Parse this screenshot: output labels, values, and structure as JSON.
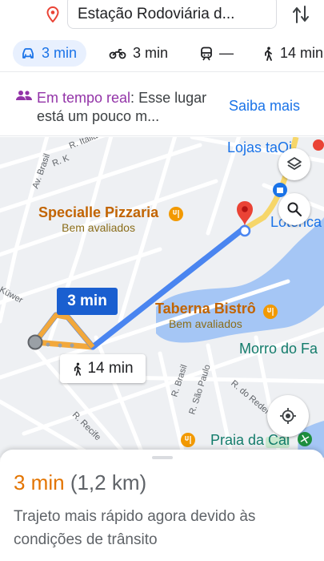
{
  "search": {
    "destination": "Estação Rodoviária d...",
    "pin_icon": "location-pin-icon",
    "swap_icon": "swap-vertical-icon"
  },
  "modes": {
    "car": {
      "label": "3 min",
      "icon": "car-icon",
      "active": true
    },
    "motorcycle": {
      "label": "3 min",
      "icon": "motorcycle-icon"
    },
    "transit": {
      "label": "—",
      "icon": "train-icon"
    },
    "walk": {
      "label": "14 min",
      "icon": "walk-icon"
    }
  },
  "banner": {
    "icon": "people-icon",
    "realtime_label": "Em tempo real",
    "colon": ":",
    "message": " Esse lugar está um pouco m...",
    "link": "Saiba mais"
  },
  "map": {
    "places": {
      "lojas": "Lojas taQi",
      "specialle_name": "Specialle Pizzaria",
      "specialle_sub": "Bem avaliados",
      "taberna_name": "Taberna Bistrô",
      "taberna_sub": "Bem avaliados",
      "lotérica": "Lotérica",
      "morro": "Morro do Fa",
      "praia": "Praia da Cal"
    },
    "streets": {
      "italia": "R. Itália",
      "brasil_av": "Av. Brasil",
      "rk": "R. K",
      "kuwer": "Küwer",
      "recife": "R. Recife",
      "r_brasil": "R. Brasil",
      "sao_paulo": "R. São Paulo",
      "do_reder": "R. do Reder"
    },
    "route_car_label": "3 min",
    "route_walk_label": "14 min",
    "buttons": {
      "layers": "layers-icon",
      "search": "search-icon",
      "location": "my-location-icon"
    },
    "colors": {
      "route_primary": "#4a85f0",
      "route_alt": "#f2a83b",
      "water": "#a5c6f5",
      "pin": "#ea4335"
    }
  },
  "sheet": {
    "eta_time": "3 min",
    "eta_distance": "(1,2 km)",
    "description": "Trajeto mais rápido agora devido às condições de trânsito"
  }
}
